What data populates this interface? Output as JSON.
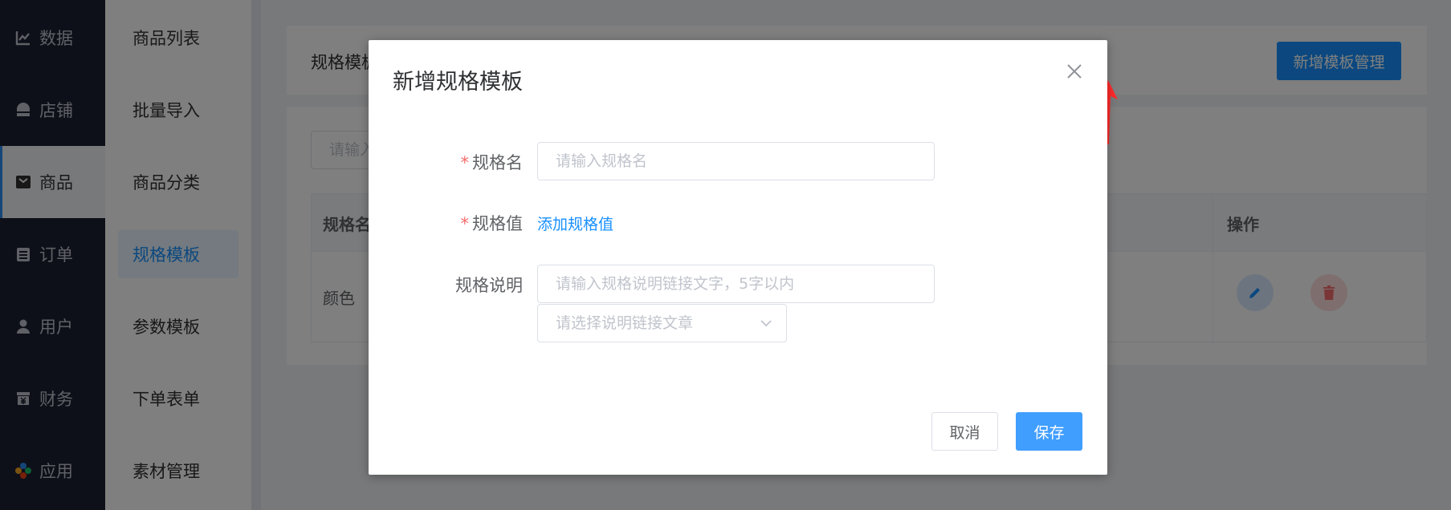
{
  "nav_primary": [
    {
      "label": "数据",
      "icon": "chart-icon"
    },
    {
      "label": "店铺",
      "icon": "store-icon"
    },
    {
      "label": "商品",
      "icon": "goods-icon",
      "active": true
    },
    {
      "label": "订单",
      "icon": "order-icon"
    },
    {
      "label": "用户",
      "icon": "user-icon"
    },
    {
      "label": "财务",
      "icon": "finance-icon"
    },
    {
      "label": "应用",
      "icon": "app-icon"
    }
  ],
  "nav_secondary": [
    {
      "label": "商品列表"
    },
    {
      "label": "批量导入"
    },
    {
      "label": "商品分类"
    },
    {
      "label": "规格模板",
      "active": true
    },
    {
      "label": "参数模板"
    },
    {
      "label": "下单表单"
    },
    {
      "label": "素材管理"
    }
  ],
  "page": {
    "title": "规格模板",
    "add_button": "新增模板管理",
    "search_placeholder": "请输入"
  },
  "table": {
    "headers": [
      "规格名",
      "操作"
    ],
    "rows": [
      {
        "name": "颜色"
      }
    ]
  },
  "modal": {
    "title": "新增规格模板",
    "fields": {
      "spec_name_label": "规格名",
      "spec_name_placeholder": "请输入规格名",
      "spec_value_label": "规格值",
      "spec_value_link": "添加规格值",
      "spec_desc_label": "规格说明",
      "spec_desc_placeholder": "请输入规格说明链接文字，5字以内",
      "spec_article_placeholder": "请选择说明链接文章"
    },
    "cancel": "取消",
    "save": "保存"
  },
  "colors": {
    "primary": "#1890ff",
    "sidebar": "#1d2133",
    "required": "#f56c6c",
    "annotation_arrow": "#ff2a2a"
  }
}
